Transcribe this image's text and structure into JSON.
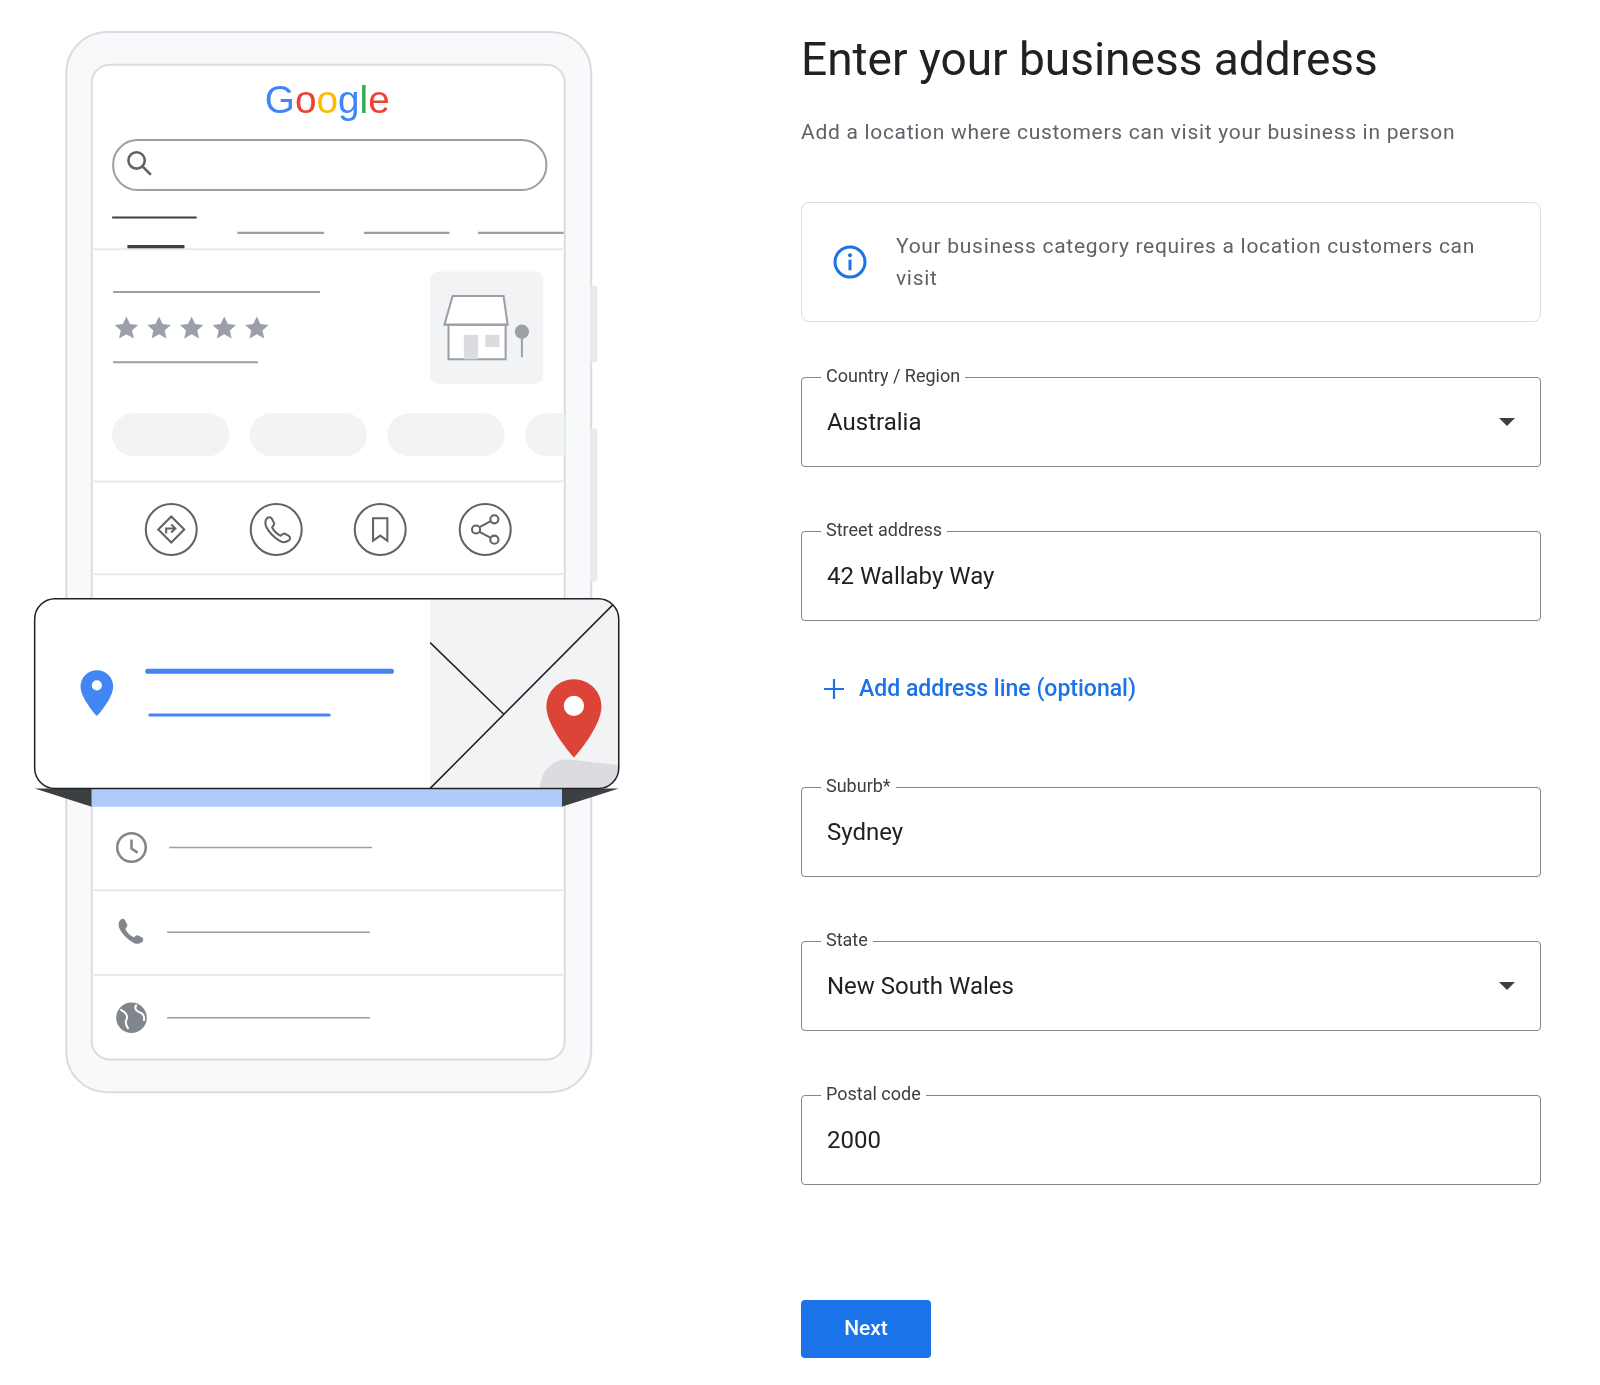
{
  "illustration": {
    "logo": "Google"
  },
  "title": "Enter your business address",
  "subtitle": "Add a location where customers can visit your business in person",
  "info": {
    "text": "Your business category requires a location customers can visit"
  },
  "fields": [
    {
      "kind": "select",
      "label": "Country / Region",
      "value": "Australia"
    },
    {
      "kind": "text",
      "label": "Street address",
      "value": "42 Wallaby Way"
    },
    {
      "kind": "add_link",
      "label": "Add address line (optional)"
    },
    {
      "kind": "text",
      "label": "Suburb*",
      "value": "Sydney"
    },
    {
      "kind": "select",
      "label": "State",
      "value": "New South Wales"
    },
    {
      "kind": "text",
      "label": "Postal code",
      "value": "2000"
    }
  ],
  "next_button": "Next"
}
